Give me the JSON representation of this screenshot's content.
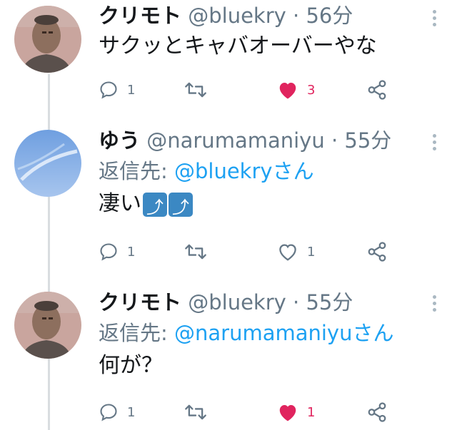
{
  "tweets": [
    {
      "name": "クリモト",
      "handle": "@bluekry",
      "time": "· 56分",
      "reply_prefix": "",
      "reply_handle": "",
      "text": "サクッとキャバオーバーやな",
      "replies": "1",
      "likes": "3",
      "liked": true,
      "avatar": "man-avatar"
    },
    {
      "name": "ゆう",
      "handle": "@narumamaniyu",
      "time": "· 55分",
      "reply_prefix": "返信先: ",
      "reply_handle": "@bluekryさん",
      "text": "凄い",
      "emoji": [
        "⤴",
        "⤴"
      ],
      "replies": "1",
      "likes": "1",
      "liked": false,
      "avatar": "sky-avatar"
    },
    {
      "name": "クリモト",
      "handle": "@bluekry",
      "time": "· 55分",
      "reply_prefix": "返信先: ",
      "reply_handle": "@narumamaniyuさん",
      "text": "何が？",
      "replies": "1",
      "likes": "1",
      "liked": true,
      "avatar": "man-avatar"
    }
  ],
  "colors": {
    "accent": "#1da1f2",
    "like": "#e0245e",
    "muted": "#657786",
    "text": "#14171a"
  }
}
